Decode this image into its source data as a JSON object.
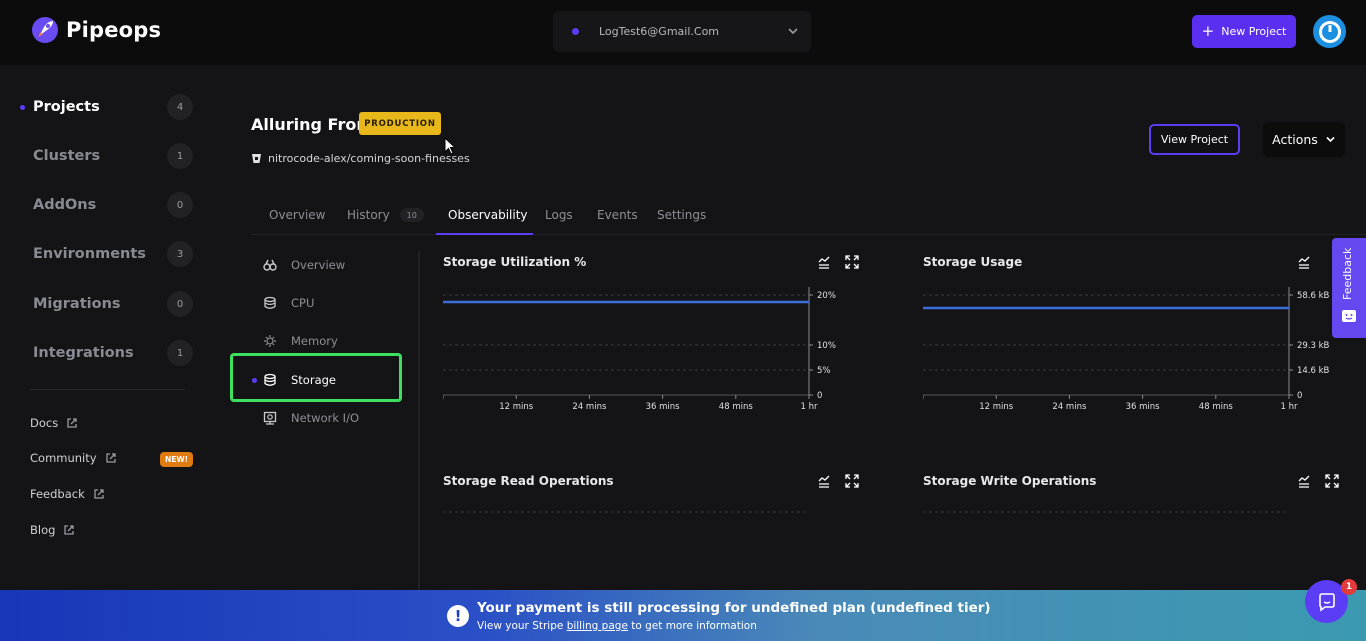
{
  "header": {
    "brand": "Pipeops",
    "org": "LogTest6@Gmail.Com",
    "new_project": "New Project"
  },
  "sidebar": {
    "items": [
      {
        "label": "Projects",
        "count": "4"
      },
      {
        "label": "Clusters",
        "count": "1"
      },
      {
        "label": "AddOns",
        "count": "0"
      },
      {
        "label": "Environments",
        "count": "3"
      },
      {
        "label": "Migrations",
        "count": "0"
      },
      {
        "label": "Integrations",
        "count": "1"
      }
    ],
    "links": [
      "Docs",
      "Community",
      "Feedback",
      "Blog"
    ],
    "new_badge": "NEW!"
  },
  "project": {
    "title": "Alluring Front",
    "badge": "PRODUCTION",
    "repo": "nitrocode-alex/coming-soon-finesses",
    "view_project": "View Project",
    "actions": "Actions"
  },
  "tabs": [
    {
      "label": "Overview"
    },
    {
      "label": "History",
      "count": "10"
    },
    {
      "label": "Observability"
    },
    {
      "label": "Logs"
    },
    {
      "label": "Events"
    },
    {
      "label": "Settings"
    }
  ],
  "subnav": [
    "Overview",
    "CPU",
    "Memory",
    "Storage",
    "Network I/O"
  ],
  "chart_data": [
    {
      "type": "line",
      "title": "Storage Utilization %",
      "x_ticks": [
        "12 mins",
        "24 mins",
        "36 mins",
        "48 mins",
        "1 hr"
      ],
      "y_ticks": [
        "20%",
        "10%",
        "5%",
        "0"
      ],
      "series": [
        {
          "values": [
            18.6,
            18.6,
            18.6,
            18.6,
            18.6,
            18.6
          ]
        }
      ],
      "ylim": [
        0,
        20
      ]
    },
    {
      "type": "line",
      "title": "Storage Usage",
      "x_ticks": [
        "12 mins",
        "24 mins",
        "36 mins",
        "48 mins",
        "1 hr"
      ],
      "y_ticks": [
        "58.6 kB",
        "29.3 kB",
        "14.6 kB",
        "0"
      ],
      "series": [
        {
          "values": [
            51,
            51,
            51,
            51,
            51,
            51
          ]
        }
      ],
      "ylim": [
        0,
        58.6
      ]
    },
    {
      "type": "line",
      "title": "Storage Read Operations"
    },
    {
      "type": "line",
      "title": "Storage Write Operations"
    }
  ],
  "feedback_tab": "Feedback",
  "banner": {
    "title": "Your payment is still processing for undefined plan (undefined tier)",
    "sub_before": "View your Stripe",
    "sub_link": "billing page",
    "sub_after": "to get more information"
  },
  "chat_badge": "1"
}
